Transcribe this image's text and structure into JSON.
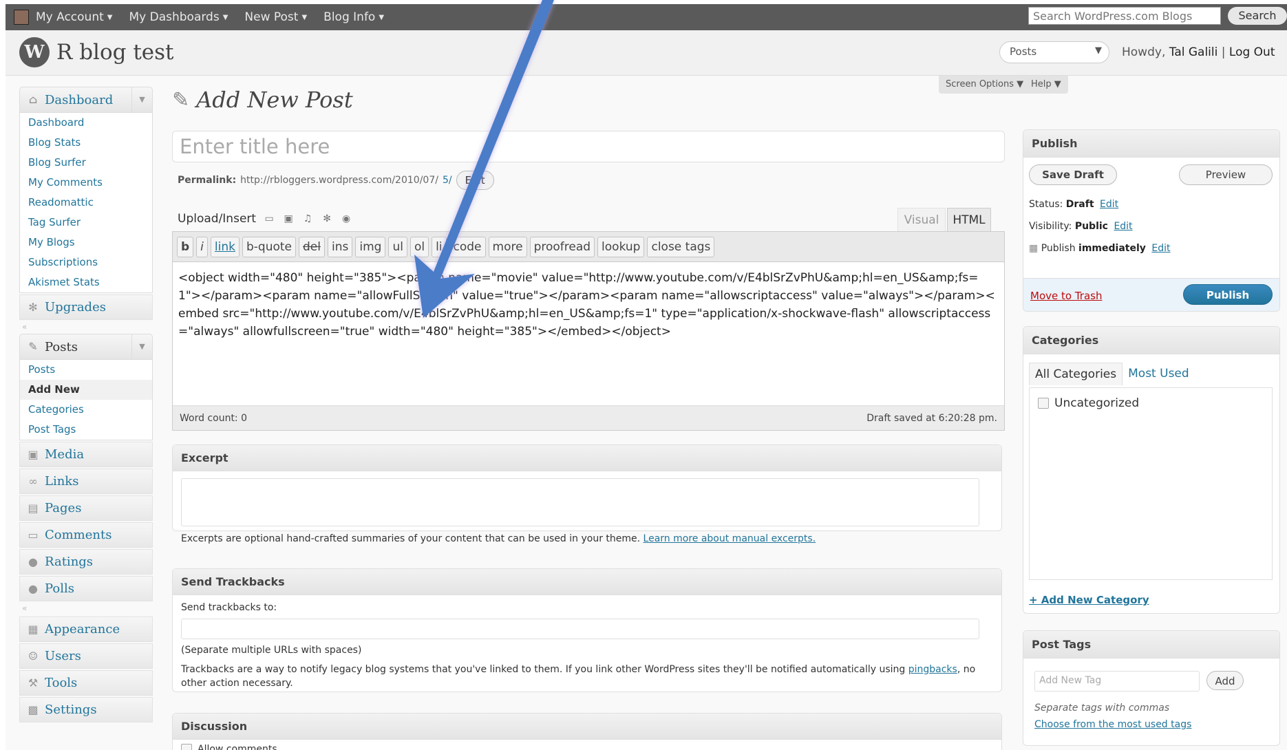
{
  "adminbar": {
    "menus": [
      {
        "label": "My Account"
      },
      {
        "label": "My Dashboards"
      },
      {
        "label": "New Post"
      },
      {
        "label": "Blog Info"
      }
    ],
    "search_placeholder": "Search WordPress.com Blogs",
    "search_button": "Search"
  },
  "header": {
    "blog_name": "R blog test",
    "favorite_actions": "Posts",
    "howdy_prefix": "Howdy,",
    "user_name": "Tal Galili",
    "separator": "|",
    "logout": "Log Out"
  },
  "screen_options": {
    "label": "Screen Options",
    "help": "Help"
  },
  "sidebar": {
    "dashboard": {
      "label": "Dashboard",
      "items": [
        "Dashboard",
        "Blog Stats",
        "Blog Surfer",
        "My Comments",
        "Readomattic",
        "Tag Surfer",
        "My Blogs",
        "Subscriptions",
        "Akismet Stats"
      ]
    },
    "upgrades": "Upgrades",
    "posts": {
      "label": "Posts",
      "items": [
        "Posts",
        "Add New",
        "Categories",
        "Post Tags"
      ]
    },
    "group2": [
      "Media",
      "Links",
      "Pages",
      "Comments",
      "Ratings",
      "Polls"
    ],
    "group3": [
      "Appearance",
      "Users",
      "Tools",
      "Settings"
    ]
  },
  "main": {
    "page_title": "Add New Post",
    "title_placeholder": "Enter title here",
    "permalink_label": "Permalink:",
    "permalink_url": "http://rbloggers.wordpress.com/2010/07/",
    "permalink_suffix": "5/",
    "permalink_edit": "Edit",
    "upload_insert": "Upload/Insert",
    "tab_visual": "Visual",
    "tab_html": "HTML",
    "quicktags": [
      "b",
      "i",
      "link",
      "b-quote",
      "del",
      "ins",
      "img",
      "ul",
      "ol",
      "li",
      "code",
      "more",
      "proofread",
      "lookup",
      "close tags"
    ],
    "content": "<object width=\"480\" height=\"385\"><param name=\"movie\" value=\"http://www.youtube.com/v/E4blSrZvPhU&amp;hl=en_US&amp;fs=1\"></param><param name=\"allowFullScreen\" value=\"true\"></param><param name=\"allowscriptaccess\" value=\"always\"></param><embed src=\"http://www.youtube.com/v/E4blSrZvPhU&amp;hl=en_US&amp;fs=1\" type=\"application/x-shockwave-flash\" allowscriptaccess=\"always\" allowfullscreen=\"true\" width=\"480\" height=\"385\"></embed></object>",
    "word_count": "Word count: 0",
    "draft_saved": "Draft saved at 6:20:28 pm."
  },
  "excerpt": {
    "title": "Excerpt",
    "help": "Excerpts are optional hand-crafted summaries of your content that can be used in your theme.",
    "link": "Learn more about manual excerpts."
  },
  "trackbacks": {
    "title": "Send Trackbacks",
    "label": "Send trackbacks to:",
    "hint": "(Separate multiple URLs with spaces)",
    "help": "Trackbacks are a way to notify legacy blog systems that you've linked to them. If you link other WordPress sites they'll be notified automatically using",
    "link": "pingbacks",
    "help_end": ", no other action necessary."
  },
  "discussion": {
    "title": "Discussion",
    "allow_comments": "Allow comments"
  },
  "publish": {
    "title": "Publish",
    "save_draft": "Save Draft",
    "preview": "Preview",
    "status_label": "Status:",
    "status_value": "Draft",
    "visibility_label": "Visibility:",
    "visibility_value": "Public",
    "publish_label": "Publish",
    "publish_value": "immediately",
    "edit": "Edit",
    "trash": "Move to Trash",
    "publish_button": "Publish"
  },
  "categories": {
    "title": "Categories",
    "tab_all": "All Categories",
    "tab_most": "Most Used",
    "items": [
      "Uncategorized"
    ],
    "add_new": "+ Add New Category"
  },
  "tags": {
    "title": "Post Tags",
    "placeholder": "Add New Tag",
    "add": "Add",
    "hint": "Separate tags with commas",
    "choose": "Choose from the most used tags"
  },
  "colors": {
    "link": "#21759b",
    "adminbar": "#5a5a5a",
    "publish": "#21759b",
    "annotation_arrow": "#4a7cc8"
  }
}
